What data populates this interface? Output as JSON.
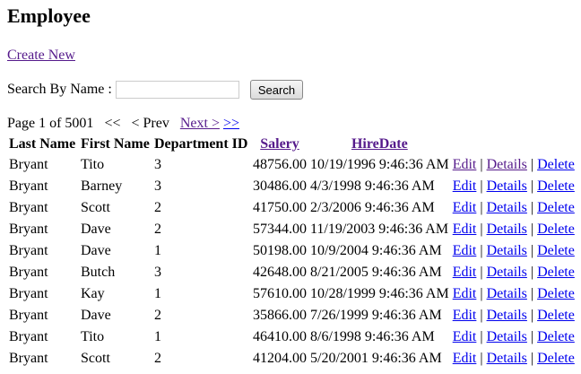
{
  "title": "Employee",
  "create_new": "Create New",
  "search": {
    "label": "Search By Name :",
    "value": "",
    "button": "Search"
  },
  "pager": {
    "info": "Page 1 of 5001",
    "first": "<<",
    "prev": "< Prev",
    "next": "Next >",
    "last": ">>"
  },
  "columns": [
    "Last Name",
    "First Name",
    "Department ID",
    "Salery",
    "HireDate"
  ],
  "actions": {
    "edit": "Edit",
    "details": "Details",
    "delete": "Delete",
    "sep": "|"
  },
  "rows": [
    [
      "Bryant",
      "Tito",
      "3",
      "48756.00",
      "10/19/1996 9:46:36 AM"
    ],
    [
      "Bryant",
      "Barney",
      "3",
      "30486.00",
      "4/3/1998 9:46:36 AM"
    ],
    [
      "Bryant",
      "Scott",
      "2",
      "41750.00",
      "2/3/2006 9:46:36 AM"
    ],
    [
      "Bryant",
      "Dave",
      "2",
      "57344.00",
      "11/19/2003 9:46:36 AM"
    ],
    [
      "Bryant",
      "Dave",
      "1",
      "50198.00",
      "10/9/2004 9:46:36 AM"
    ],
    [
      "Bryant",
      "Butch",
      "3",
      "42648.00",
      "8/21/2005 9:46:36 AM"
    ],
    [
      "Bryant",
      "Kay",
      "1",
      "57610.00",
      "10/28/1999 9:46:36 AM"
    ],
    [
      "Bryant",
      "Dave",
      "2",
      "35866.00",
      "7/26/1999 9:46:36 AM"
    ],
    [
      "Bryant",
      "Tito",
      "1",
      "46410.00",
      "8/6/1998 9:46:36 AM"
    ],
    [
      "Bryant",
      "Scott",
      "2",
      "41204.00",
      "5/20/2001 9:46:36 AM"
    ]
  ],
  "colors": {
    "link": "#0000ee",
    "visited_link": "#551a8b"
  }
}
